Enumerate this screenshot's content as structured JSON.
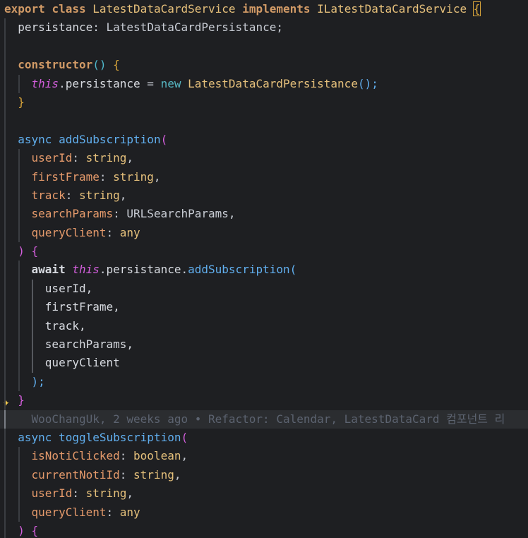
{
  "code": {
    "l1": {
      "export": "export",
      "class": "class",
      "name": "LatestDataCardService",
      "implements": "implements",
      "iface": "ILatestDataCardService",
      "brace": "{"
    },
    "l2": {
      "prop": "persistance",
      "colon": ":",
      "type": "LatestDataCardPersistance",
      "semi": ";"
    },
    "l4": {
      "ctor": "constructor",
      "parens": "()",
      "brace": "{"
    },
    "l5": {
      "this": "this",
      "dot": ".",
      "prop": "persistance",
      "eq": " = ",
      "new": "new",
      "cls": "LatestDataCardPersistance",
      "call": "();"
    },
    "l6": {
      "brace": "}"
    },
    "l8": {
      "async": "async",
      "fn": "addSubscription",
      "paren": "("
    },
    "l9": {
      "p": "userId",
      "rest": ": ",
      "t": "string",
      "c": ","
    },
    "l10": {
      "p": "firstFrame",
      "rest": ": ",
      "t": "string",
      "c": ","
    },
    "l11": {
      "p": "track",
      "rest": ": ",
      "t": "string",
      "c": ","
    },
    "l12": {
      "p": "searchParams",
      "rest": ": ",
      "t": "URLSearchParams",
      "c": ","
    },
    "l13": {
      "p": "queryClient",
      "rest": ": ",
      "t": "any"
    },
    "l14": {
      "paren": ")",
      "brace": "{"
    },
    "l15": {
      "await": "await",
      "this": "this",
      "dot": ".",
      "prop": "persistance",
      "dot2": ".",
      "fn": "addSubscription",
      "paren": "("
    },
    "l16": {
      "a": "userId,"
    },
    "l17": {
      "a": "firstFrame,"
    },
    "l18": {
      "a": "track,"
    },
    "l19": {
      "a": "searchParams,"
    },
    "l20": {
      "a": "queryClient"
    },
    "l21": {
      "close": ");"
    },
    "l22": {
      "brace": "}",
      "icon": "✦"
    },
    "l23": {
      "blame": "WooChangUk, 2 weeks ago • Refactor: Calendar, LatestDataCard 컴포넌트 리"
    },
    "l24": {
      "async": "async",
      "fn": "toggleSubscription",
      "paren": "("
    },
    "l25": {
      "p": "isNotiClicked",
      "rest": ": ",
      "t": "boolean",
      "c": ","
    },
    "l26": {
      "p": "currentNotiId",
      "rest": ": ",
      "t": "string",
      "c": ","
    },
    "l27": {
      "p": "userId",
      "rest": ": ",
      "t": "string",
      "c": ","
    },
    "l28": {
      "p": "queryClient",
      "rest": ": ",
      "t": "any"
    },
    "l29": {
      "paren": ")",
      "brace": "{"
    }
  }
}
